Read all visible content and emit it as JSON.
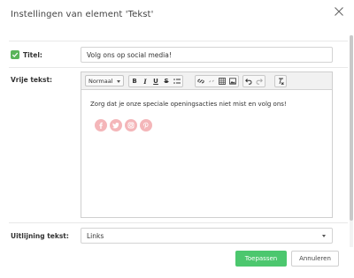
{
  "dialog": {
    "title": "Instellingen van element 'Tekst'"
  },
  "fields": {
    "title_label": "Titel:",
    "title_value": "Volg ons op social media!",
    "title_checked": true,
    "free_text_label": "Vrije tekst:",
    "align_label": "Uitlijning tekst:",
    "align_value": "Links"
  },
  "editor": {
    "format_value": "Normaal",
    "toolbar": {
      "bold": "B",
      "italic": "I",
      "underline": "U",
      "strike": "S"
    },
    "body_text": "Zorg dat je onze speciale openingsacties niet mist en volg ons!",
    "social_icons": [
      "facebook-icon",
      "twitter-icon",
      "instagram-icon",
      "pinterest-icon"
    ],
    "social_color": "#f4b6b9"
  },
  "buttons": {
    "apply": "Toepassen",
    "cancel": "Annuleren"
  },
  "colors": {
    "accent": "#4cc76e",
    "checkbox": "#5ab45a"
  }
}
